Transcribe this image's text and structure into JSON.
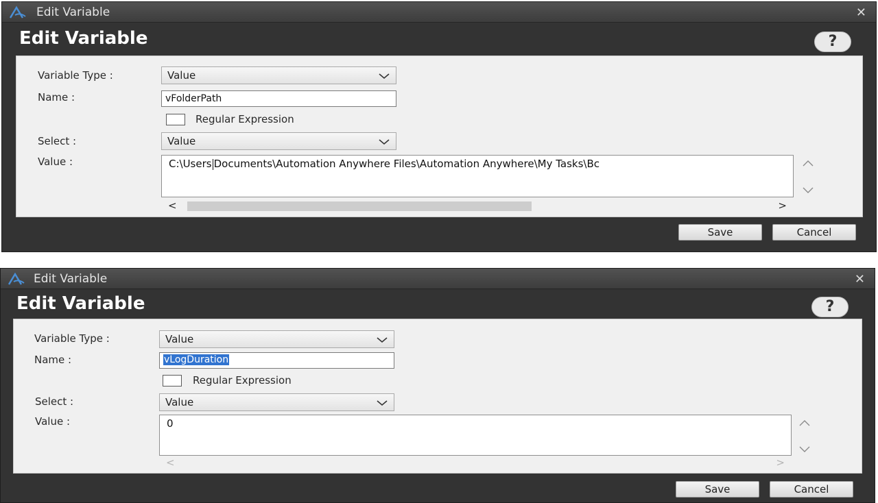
{
  "dialogs": [
    {
      "window_title": "Edit Variable",
      "heading": "Edit Variable",
      "help_label": "?",
      "variable_type_label": "Variable Type :",
      "variable_type_value": "Value",
      "name_label": "Name :",
      "name_value": "vFolderPath",
      "regex_label": "Regular Expression",
      "regex_checked": false,
      "select_label": "Select :",
      "select_value": "Value",
      "value_label": "Value :",
      "value_text_before_caret": "C:\\Users",
      "value_text_after_caret": "Documents\\Automation Anywhere Files\\Automation Anywhere\\My Tasks\\Bc",
      "save_label": "Save",
      "cancel_label": "Cancel"
    },
    {
      "window_title": "Edit Variable",
      "heading": "Edit Variable",
      "help_label": "?",
      "variable_type_label": "Variable Type :",
      "variable_type_value": "Value",
      "name_label": "Name :",
      "name_value": "vLogDuration",
      "regex_label": "Regular Expression",
      "regex_checked": false,
      "select_label": "Select :",
      "select_value": "Value",
      "value_label": "Value :",
      "value_text": "0",
      "save_label": "Save",
      "cancel_label": "Cancel"
    }
  ],
  "icons": {
    "app": "automation-anywhere-logo-icon",
    "close": "close-icon",
    "dropdown": "chevron-down-icon",
    "scroll_up": "chevron-up-icon",
    "scroll_down": "chevron-down-icon",
    "scroll_left": "arrow-left-icon",
    "scroll_right": "arrow-right-icon"
  },
  "colors": {
    "window_bg": "#333333",
    "panel_bg": "#f0f0f0",
    "logo_blue": "#4a8fd6",
    "selection_blue": "#3174d0"
  }
}
